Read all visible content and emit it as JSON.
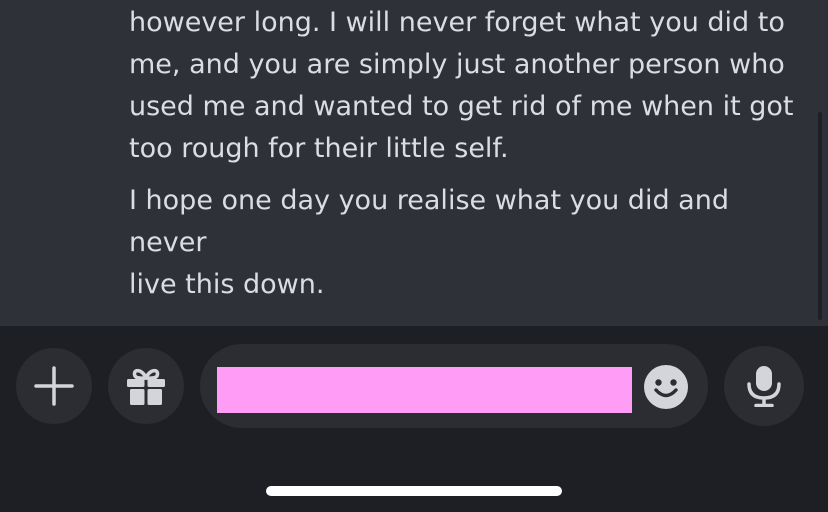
{
  "messages": [
    {
      "lines": [
        "however long. I will never forget what you did to",
        "me, and you are simply just another person who",
        "used me and wanted to get rid of me when it got",
        "too rough for their little self."
      ]
    },
    {
      "lines": [
        "I hope one day you realise what you did and never",
        "live this down."
      ]
    }
  ],
  "composer": {
    "input_value": "",
    "icons": {
      "add": "plus-icon",
      "gift": "gift-icon",
      "emoji": "smiley-icon",
      "voice": "microphone-icon"
    },
    "redaction_color": "#ff9cf6"
  },
  "colors": {
    "chat_background": "#2f3139",
    "composer_background": "#1e1f24",
    "button_background": "#2b2d33",
    "message_text": "#dcdde2",
    "icon": "#d4d5da"
  }
}
